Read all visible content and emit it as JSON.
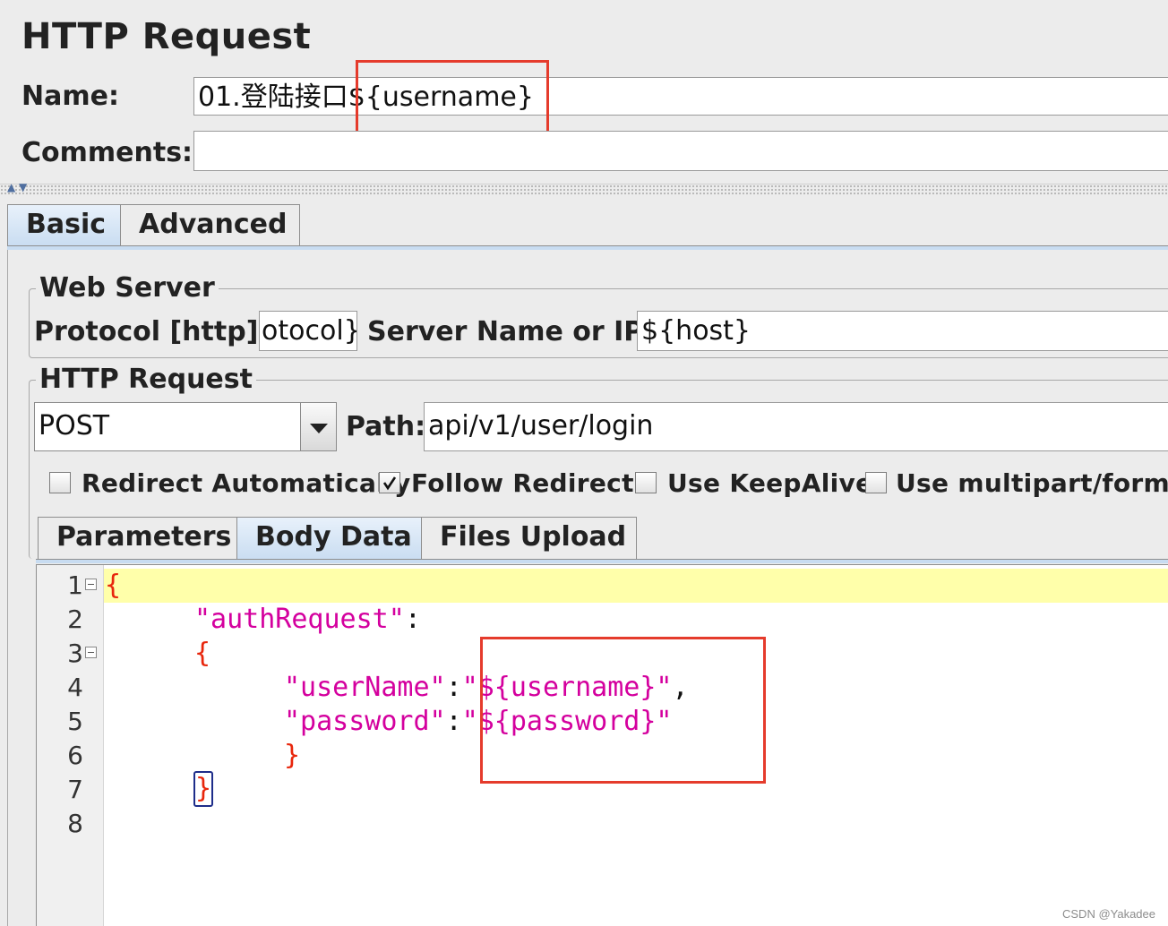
{
  "header": {
    "title": "HTTP Request",
    "name_label": "Name:",
    "name_value": "01.登陆接口${username}",
    "comments_label": "Comments:",
    "comments_value": ""
  },
  "tabs": {
    "basic": "Basic",
    "advanced": "Advanced",
    "selected": "Basic"
  },
  "web_server": {
    "title": "Web Server",
    "protocol_label": "Protocol [http]:",
    "protocol_value": "otocol}",
    "server_label": "Server Name or IP:",
    "server_value": "${host}"
  },
  "http_request": {
    "title": "HTTP Request",
    "method": "POST",
    "path_label": "Path:",
    "path_value": "api/v1/user/login"
  },
  "options": [
    {
      "label": "Redirect Automatically",
      "checked": false
    },
    {
      "label": "Follow Redirects",
      "checked": true
    },
    {
      "label": "Use KeepAlive",
      "checked": false
    },
    {
      "label": "Use multipart/form-d",
      "checked": false
    }
  ],
  "body_tabs": {
    "parameters": "Parameters",
    "body_data": "Body Data",
    "files_upload": "Files Upload",
    "selected": "Body Data"
  },
  "editor": {
    "line_numbers": [
      "1",
      "2",
      "3",
      "4",
      "5",
      "6",
      "7",
      "8"
    ],
    "l1_open": "{",
    "l2_key": "\"authRequest\"",
    "l2_colon": ":",
    "l3_open": "{",
    "l4_key": "\"userName\"",
    "l4_colon": ":",
    "l4_val": "\"${username}\"",
    "l4_comma": ",",
    "l5_key": "\"password\"",
    "l5_colon": ":",
    "l5_val": "\"${password}\"",
    "l6_close": "}",
    "l7_close": "}"
  },
  "watermark": "CSDN @Yakadee",
  "colors": {
    "annotation_box": "#e53b2c",
    "json_string": "#d4009e",
    "json_brace": "#e8260c",
    "current_line": "#ffffaa",
    "tab_selected": "#c8dcf1"
  }
}
